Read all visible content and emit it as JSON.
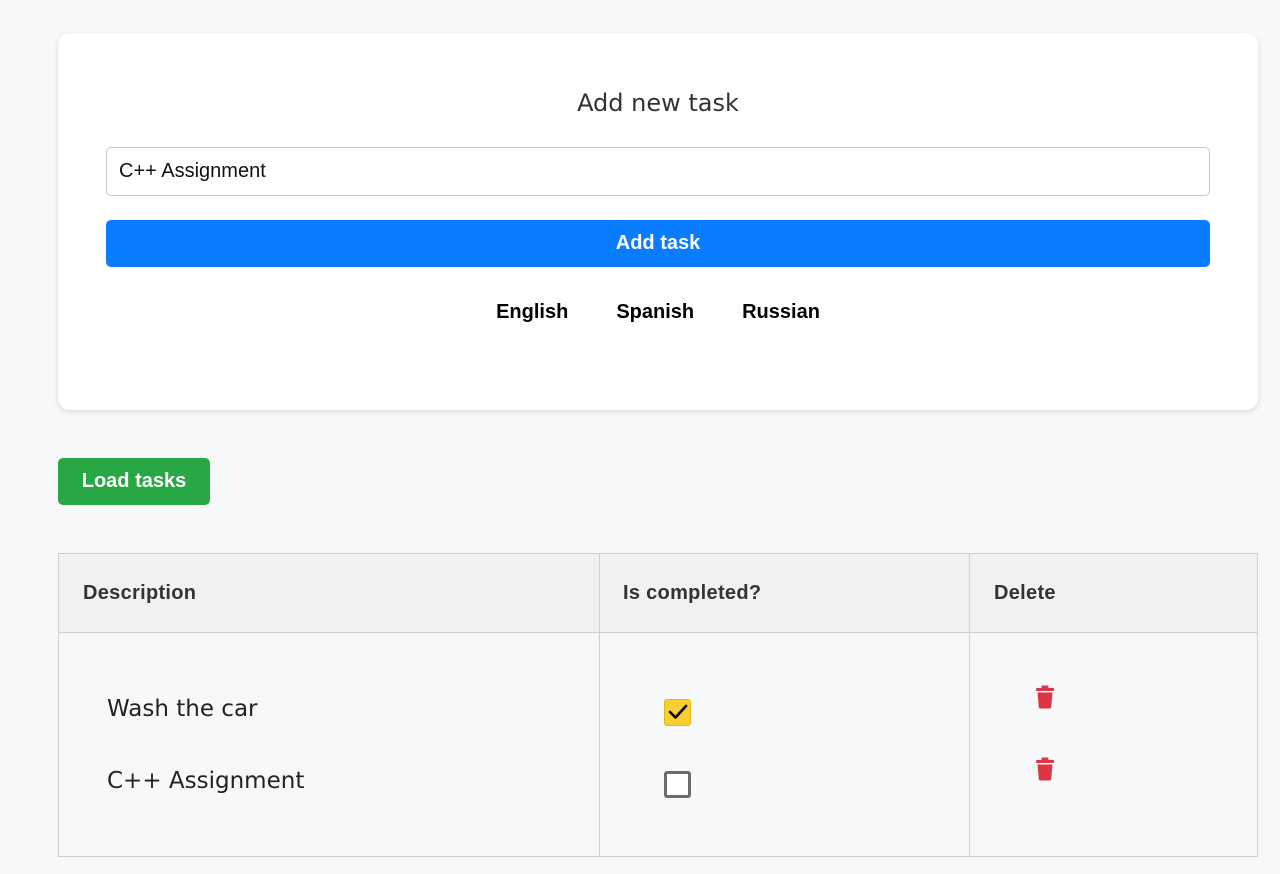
{
  "form": {
    "title": "Add new task",
    "input_value": "C++ Assignment",
    "input_placeholder": "",
    "add_button_label": "Add task",
    "languages": [
      "English",
      "Spanish",
      "Russian"
    ]
  },
  "load_button_label": "Load tasks",
  "table": {
    "headers": [
      "Description",
      "Is completed?",
      "Delete"
    ],
    "rows": [
      {
        "description": "Wash the car",
        "completed": true,
        "delete_icon": "trash-icon"
      },
      {
        "description": "C++ Assignment",
        "completed": false,
        "delete_icon": "trash-icon"
      }
    ]
  },
  "colors": {
    "primary": "#0a7cff",
    "success": "#28a745",
    "checked": "#f7cf32",
    "danger": "#dc3545"
  }
}
